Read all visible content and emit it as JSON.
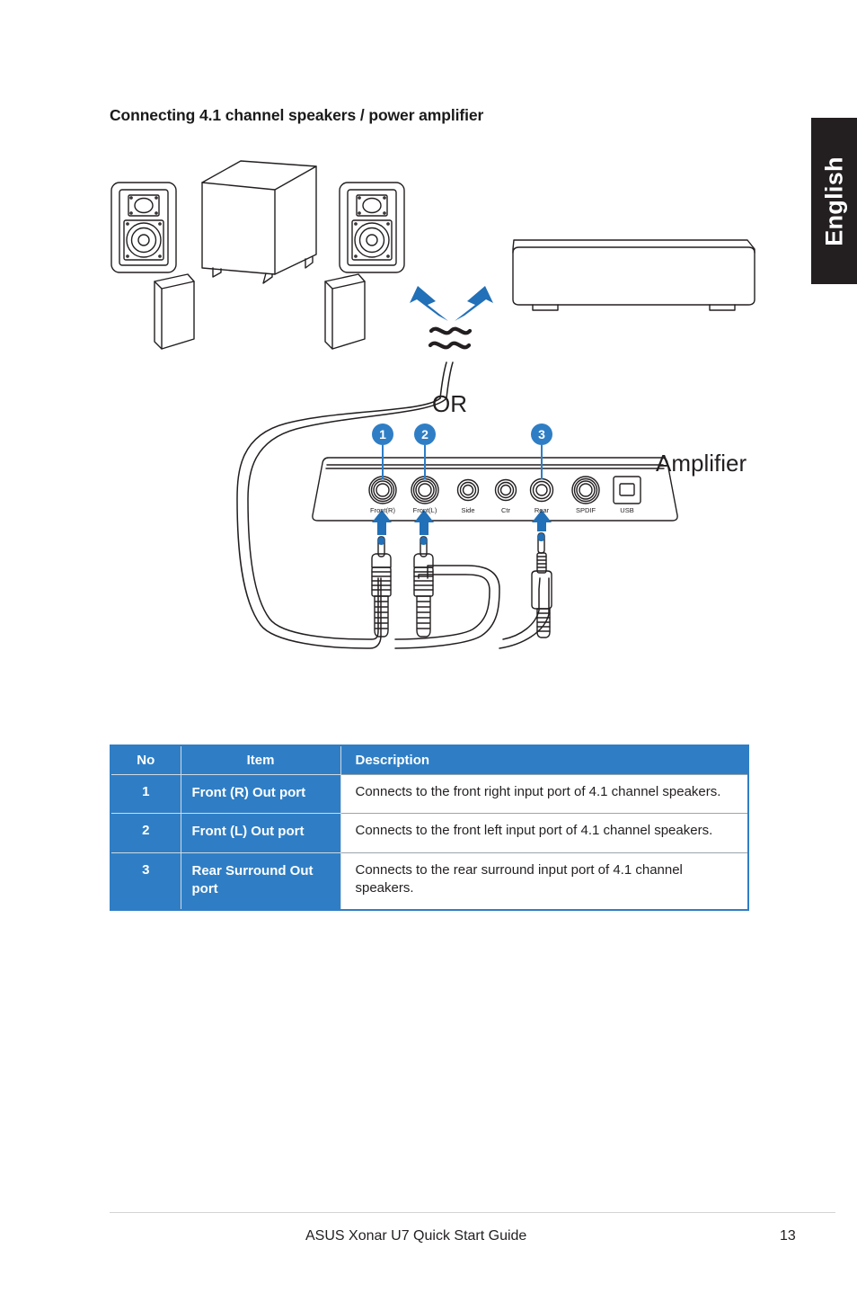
{
  "page": {
    "heading": "Connecting 4.1 channel speakers / power amplifier",
    "language_tab": "English",
    "footer_text": "ASUS Xonar U7 Quick Start Guide",
    "page_number": "13",
    "accent_blue": "#2f7ec5",
    "dark": "#231f20"
  },
  "diagram": {
    "or_label": "OR",
    "amplifier_label": "Amplifier",
    "callouts": [
      {
        "number": "1",
        "target": "Front(R)"
      },
      {
        "number": "2",
        "target": "Front(L)"
      },
      {
        "number": "3",
        "target": "Rear"
      }
    ],
    "device_ports": [
      {
        "label": "Front(R)",
        "type": "jack"
      },
      {
        "label": "Front(L)",
        "type": "jack"
      },
      {
        "label": "Side",
        "type": "jack"
      },
      {
        "label": "Ctr",
        "type": "jack"
      },
      {
        "label": "Rear",
        "type": "jack"
      },
      {
        "label": "SPDIF",
        "type": "jack"
      },
      {
        "label": "USB",
        "type": "usb-b"
      }
    ]
  },
  "table": {
    "headers": {
      "no": "No",
      "item": "Item",
      "description": "Description"
    },
    "rows": [
      {
        "no": "1",
        "item": "Front (R) Out port",
        "description": "Connects to the front right input port of 4.1 channel speakers."
      },
      {
        "no": "2",
        "item": "Front (L) Out port",
        "description": "Connects to the front left input port of 4.1 channel speakers."
      },
      {
        "no": "3",
        "item": "Rear Surround Out port",
        "description": "Connects to the rear surround input port of 4.1 channel speakers."
      }
    ]
  }
}
